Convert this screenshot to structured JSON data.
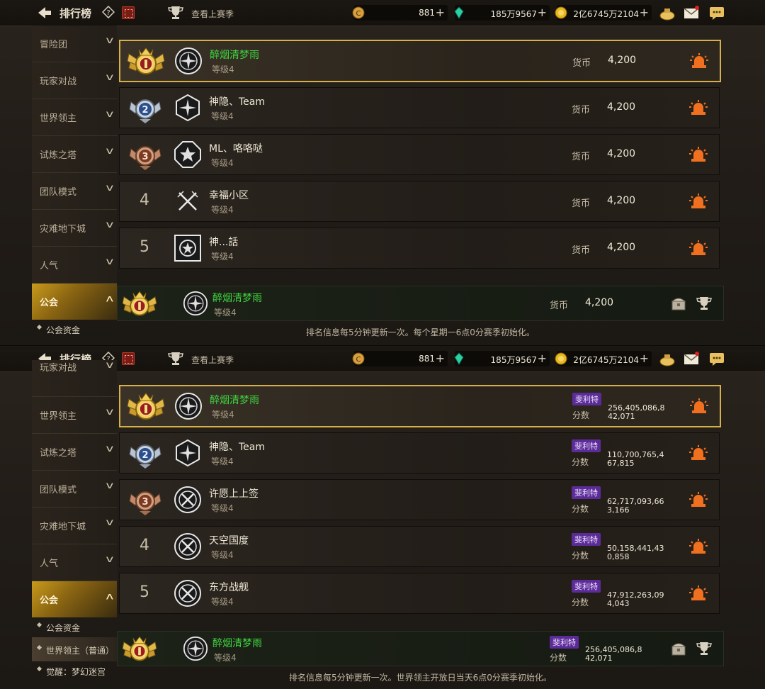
{
  "header": {
    "title": "排行榜",
    "last_season": "查看上赛季",
    "currency1": "881",
    "currency2": "185万9567",
    "currency3": "2亿6745万2104"
  },
  "panel1": {
    "sidebar": [
      {
        "label": "冒险团"
      },
      {
        "label": "玩家对战"
      },
      {
        "label": "世界领主"
      },
      {
        "label": "试炼之塔"
      },
      {
        "label": "团队模式"
      },
      {
        "label": "灾难地下城"
      },
      {
        "label": "人气"
      },
      {
        "label": "公会"
      }
    ],
    "subitems": [
      {
        "label": "公会资金"
      }
    ],
    "rows": [
      {
        "rank": "1",
        "name": "醉烟清梦雨",
        "level": "等级4",
        "currency_label": "货币",
        "value": "4,200"
      },
      {
        "rank": "2",
        "name": "神隐、Team",
        "level": "等级4",
        "currency_label": "货币",
        "value": "4,200"
      },
      {
        "rank": "3",
        "name": "ML、咯咯哒",
        "level": "等级4",
        "currency_label": "货币",
        "value": "4,200"
      },
      {
        "rank": "4",
        "name": "幸福小区",
        "level": "等级4",
        "currency_label": "货币",
        "value": "4,200"
      },
      {
        "rank": "5",
        "name": "神...話",
        "level": "等级4",
        "currency_label": "货币",
        "value": "4,200"
      }
    ],
    "mine": {
      "name": "醉烟清梦雨",
      "level": "等级4",
      "currency_label": "货币",
      "value": "4,200"
    },
    "notice": "排名信息每5分钟更新一次。每个星期一6点0分赛季初始化。"
  },
  "panel2": {
    "sidebar": [
      {
        "label": "玩家对战"
      },
      {
        "label": "世界领主"
      },
      {
        "label": "试炼之塔"
      },
      {
        "label": "团队模式"
      },
      {
        "label": "灾难地下城"
      },
      {
        "label": "人气"
      },
      {
        "label": "公会"
      }
    ],
    "subitems": [
      {
        "label": "公会资金"
      },
      {
        "label": "世界领主（普通）"
      },
      {
        "label": "觉醒：梦幻迷宫"
      }
    ],
    "rows": [
      {
        "rank": "1",
        "name": "醉烟清梦雨",
        "level": "等级4",
        "badge": "斐利特",
        "score_label": "分数",
        "value": "256,405,086,842,071"
      },
      {
        "rank": "2",
        "name": "神隐、Team",
        "level": "等级4",
        "badge": "斐利特",
        "score_label": "分数",
        "value": "110,700,765,467,815"
      },
      {
        "rank": "3",
        "name": "许愿上上签",
        "level": "等级4",
        "badge": "斐利特",
        "score_label": "分数",
        "value": "62,717,093,663,166"
      },
      {
        "rank": "4",
        "name": "天空国度",
        "level": "等级4",
        "badge": "斐利特",
        "score_label": "分数",
        "value": "50,158,441,430,858"
      },
      {
        "rank": "5",
        "name": "东方战舰",
        "level": "等级4",
        "badge": "斐利特",
        "score_label": "分数",
        "value": "47,912,263,094,043"
      }
    ],
    "mine": {
      "name": "醉烟清梦雨",
      "level": "等级4",
      "badge": "斐利特",
      "score_label": "分数",
      "value": "256,405,086,842,071"
    },
    "notice": "排名信息每5分钟更新一次。世界领主开放日当天6点0分赛季初始化。"
  },
  "icons": {
    "back": "back-arrow-icon",
    "help": "help-icon",
    "gift": "gift-box-icon",
    "trophy": "trophy-icon",
    "coin": "coin-icon",
    "gem": "gem-icon",
    "gold": "gold-icon",
    "bag": "bag-icon",
    "mail": "mail-icon",
    "chat": "chat-icon",
    "alarm": "alarm-siren-icon"
  },
  "colors": {
    "accent_gold": "#d8b04a",
    "highlight_green": "#3fd33f",
    "badge_purple": "#5b2c98",
    "alarm_orange": "#f07020"
  }
}
